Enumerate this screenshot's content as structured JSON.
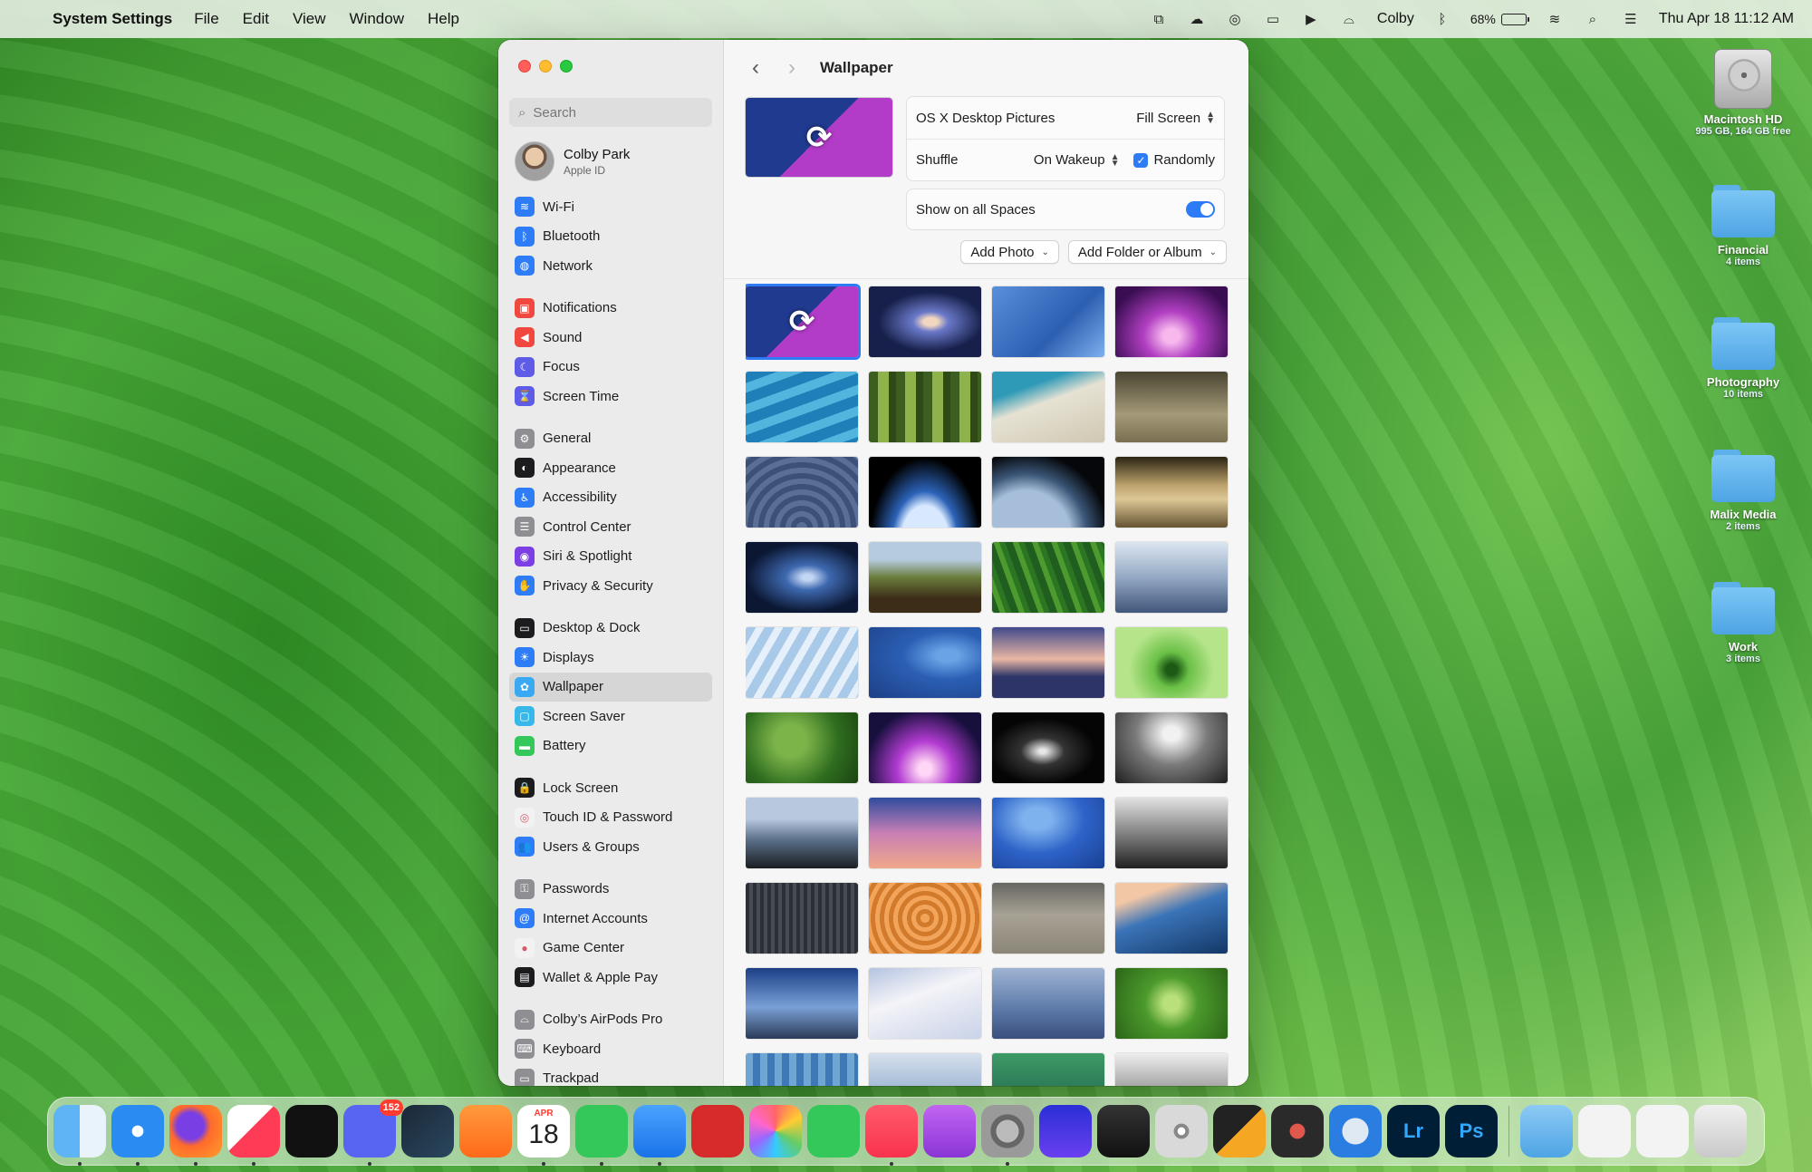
{
  "menubar": {
    "app_name": "System Settings",
    "menus": [
      "File",
      "Edit",
      "View",
      "Window",
      "Help"
    ],
    "user": "Colby",
    "battery_percent": "68%",
    "battery_level": 0.68,
    "datetime": "Thu Apr 18  11:12 AM"
  },
  "window": {
    "title": "Wallpaper",
    "search_placeholder": "Search",
    "account": {
      "name": "Colby Park",
      "subtitle": "Apple ID"
    },
    "sidebar_groups": [
      [
        {
          "label": "Wi-Fi",
          "icon": "wifi-icon",
          "color": "#2f7df6",
          "glyph": "≋"
        },
        {
          "label": "Bluetooth",
          "icon": "bluetooth-icon",
          "color": "#2f7df6",
          "glyph": "ᛒ"
        },
        {
          "label": "Network",
          "icon": "globe-icon",
          "color": "#2f7df6",
          "glyph": "◍"
        }
      ],
      [
        {
          "label": "Notifications",
          "icon": "bell-icon",
          "color": "#f0483e",
          "glyph": "▣"
        },
        {
          "label": "Sound",
          "icon": "speaker-icon",
          "color": "#f0483e",
          "glyph": "◀"
        },
        {
          "label": "Focus",
          "icon": "moon-icon",
          "color": "#5e5ce6",
          "glyph": "☾"
        },
        {
          "label": "Screen Time",
          "icon": "hourglass-icon",
          "color": "#5e5ce6",
          "glyph": "⌛"
        }
      ],
      [
        {
          "label": "General",
          "icon": "gear-icon",
          "color": "#8e8e93",
          "glyph": "⚙"
        },
        {
          "label": "Appearance",
          "icon": "appearance-icon",
          "color": "#1c1c1e",
          "glyph": "◐"
        },
        {
          "label": "Accessibility",
          "icon": "accessibility-icon",
          "color": "#2f7df6",
          "glyph": "♿"
        },
        {
          "label": "Control Center",
          "icon": "control-center-icon",
          "color": "#8e8e93",
          "glyph": "☰"
        },
        {
          "label": "Siri & Spotlight",
          "icon": "siri-icon",
          "color": "#7b3fe4",
          "glyph": "◉"
        },
        {
          "label": "Privacy & Security",
          "icon": "hand-icon",
          "color": "#2f7df6",
          "glyph": "✋"
        }
      ],
      [
        {
          "label": "Desktop & Dock",
          "icon": "dock-icon",
          "color": "#1c1c1e",
          "glyph": "▭"
        },
        {
          "label": "Displays",
          "icon": "sun-icon",
          "color": "#2f7df6",
          "glyph": "☀"
        },
        {
          "label": "Wallpaper",
          "icon": "flower-icon",
          "color": "#38a9f2",
          "glyph": "✿",
          "selected": true
        },
        {
          "label": "Screen Saver",
          "icon": "screensaver-icon",
          "color": "#38b8e8",
          "glyph": "▢"
        },
        {
          "label": "Battery",
          "icon": "battery-icon",
          "color": "#34c759",
          "glyph": "▬"
        }
      ],
      [
        {
          "label": "Lock Screen",
          "icon": "lock-icon",
          "color": "#1c1c1e",
          "glyph": "🔒"
        },
        {
          "label": "Touch ID & Password",
          "icon": "fingerprint-icon",
          "color": "#f2f2f2",
          "glyph": "◎"
        },
        {
          "label": "Users & Groups",
          "icon": "users-icon",
          "color": "#2f7df6",
          "glyph": "👥"
        }
      ],
      [
        {
          "label": "Passwords",
          "icon": "key-icon",
          "color": "#8e8e93",
          "glyph": "⚿"
        },
        {
          "label": "Internet Accounts",
          "icon": "at-icon",
          "color": "#2f7df6",
          "glyph": "@"
        },
        {
          "label": "Game Center",
          "icon": "game-center-icon",
          "color": "#f2f2f2",
          "glyph": "●"
        },
        {
          "label": "Wallet & Apple Pay",
          "icon": "wallet-icon",
          "color": "#1c1c1e",
          "glyph": "▤"
        }
      ],
      [
        {
          "label": "Colby’s AirPods Pro",
          "icon": "airpods-icon",
          "color": "#8e8e93",
          "glyph": "⌓"
        },
        {
          "label": "Keyboard",
          "icon": "keyboard-icon",
          "color": "#8e8e93",
          "glyph": "⌨"
        },
        {
          "label": "Trackpad",
          "icon": "trackpad-icon",
          "color": "#8e8e93",
          "glyph": "▭"
        }
      ]
    ],
    "wallpaper": {
      "collection": "OS X Desktop Pictures",
      "fit_mode": "Fill Screen",
      "shuffle_label": "Shuffle",
      "shuffle_value": "On Wakeup",
      "randomly_label": "Randomly",
      "randomly_checked": true,
      "show_all_spaces_label": "Show on all Spaces",
      "show_all_spaces": true,
      "add_photo": "Add Photo",
      "add_folder": "Add Folder or Album"
    },
    "thumbnails": [
      "linear-gradient(135deg,#203a8f 0 50%,#b23cc8 50%)",
      "radial-gradient(ellipse at 55% 50%,#f2d7c0 0 8%,#6a79c9 20%,#17204a 60%)",
      "linear-gradient(135deg,#5a8fdc,#2c5fb1 60%,#7fb0ee)",
      "radial-gradient(ellipse at 50% 70%,#f7b8ee 0 10%,#b13fc2 35%,#3a0d52 80%)",
      "repeating-linear-gradient(160deg,#1f7fb8 0 12px,#52b5de 12px 22px)",
      "repeating-linear-gradient(90deg,#3c5e1e 0 10px,#8fb34a 10px 22px,#2f4a16 22px 30px)",
      "linear-gradient(160deg,#2f9ab7 0 25%,#e6e2d3 45%,#cfc7b2)",
      "linear-gradient(180deg,#4a4532,#a49a79 60%,#7a6f50)",
      "repeating-radial-gradient(circle at 50% 100%,#5a6e96 0 6px,#3d5078 6px 12px)",
      "radial-gradient(ellipse at 50% 120%,#d8e9ff 0 30%,#2c63b8 42%,#000 70%)",
      "radial-gradient(ellipse at 30% 110%,#a6bed9 0 40%,#3b5677 55%,#05070a 75%)",
      "linear-gradient(180deg,#2a2412,#bca26c 40%,#ddc896 60%,#645332)",
      "radial-gradient(ellipse at 55% 50%,#c3d6f3 0 6%,#3e69b0 25%,#0b1733 70%)",
      "linear-gradient(180deg,#b6cbe0 0 25%,#6a7d3c 50%,#3c2d18 80%)",
      "repeating-linear-gradient(70deg,#1f5e1e 0 8px,#4d9a2f 8px 14px,#2c7522 14px 20px)",
      "linear-gradient(180deg,#dce6f1,#94a9c3 50%,#41567a)",
      "repeating-linear-gradient(120deg,#a9c9e8 0 10px,#e6f0fa 10px 18px)",
      "radial-gradient(ellipse at 70% 40%,#6aa3e6 0 10%,#2b5fb4 40%,#1d3f86)",
      "linear-gradient(180deg,#40498a,#e9b7a3 45%,#2d3568 70%)",
      "radial-gradient(circle at 50% 60%,#1d5a16 0 8%,#6ac046 25%,#b5e48a 60%)",
      "radial-gradient(circle at 40% 40%,#7cb44a 0 20%,#2f6d1f 60%,#1b4311)",
      "radial-gradient(ellipse at 50% 80%,#ffd6f5 0 8%,#b23bd1 35%,#17103d 75%)",
      "radial-gradient(ellipse at 45% 55%,#e6e6e6 0 4%,#333 25%,#050505 60%)",
      "radial-gradient(ellipse at 50% 30%,#f1f1f1 0 10%,#7a7a7a 45%,#1f1f1f)",
      "linear-gradient(180deg,#b7c8df 0 30%,#5a6e88 60%,#1a1e22)",
      "linear-gradient(180deg,#2f4c9e,#c87fb5 50%,#f0a88a)",
      "radial-gradient(ellipse at 40% 30%,#7eb2ee 0 15%,#2e63c8 50%,#193f92)",
      "linear-gradient(180deg,#e2e2e2,#6f6f6f 60%,#202020)",
      "repeating-linear-gradient(90deg,#2b2f36 0 4px,#464b55 4px 8px)",
      "repeating-radial-gradient(circle at 50% 50%,#f1a45a 0 5px,#d27a2c 5px 10px)",
      "linear-gradient(180deg,#666660,#a7a295 45%,#8b8677)",
      "linear-gradient(160deg,#f2c7a5 0 20%,#3a74b8 45%,#143766)",
      "linear-gradient(180deg,#1c3f86,#7aa0d6 55%,#2b3b57)",
      "linear-gradient(160deg,#b4c3e0,#f4f4f8 40%,#c9d2e8)",
      "linear-gradient(180deg,#9fb3d2,#5b78a8 60%,#3a4f7c)",
      "radial-gradient(circle at 50% 50%,#b9e07a 0 12%,#4c9a2c 40%,#2b6518)",
      "repeating-linear-gradient(90deg,#6fa6d4 0 8px,#3f78b6 8px 16px)",
      "linear-gradient(180deg,#d7e1ec,#6e91c2)",
      "linear-gradient(180deg,#3d9a64,#1a5b4e)",
      "linear-gradient(180deg,#eee,#555)"
    ],
    "selected_thumbnail": 0
  },
  "desktop_items": [
    {
      "name": "Macintosh HD",
      "sub": "995 GB, 164 GB free",
      "kind": "disk"
    },
    {
      "name": "Financial",
      "sub": "4 items",
      "kind": "folder"
    },
    {
      "name": "Photography",
      "sub": "10 items",
      "kind": "folder"
    },
    {
      "name": "Malix Media",
      "sub": "2 items",
      "kind": "folder"
    },
    {
      "name": "Work",
      "sub": "3 items",
      "kind": "folder"
    }
  ],
  "dock": {
    "apps": [
      {
        "name": "finder",
        "color": "linear-gradient(90deg,#5fb4f5 50%,#e9f3fb 50%)",
        "running": true
      },
      {
        "name": "safari",
        "color": "radial-gradient(circle,#fff 0 15%,#2a8cf2 16%)",
        "running": true
      },
      {
        "name": "firefox",
        "color": "radial-gradient(circle at 40% 40%,#7a3fe4 0 30%,#ff6a2b 45%,#ff9e2b)",
        "running": true
      },
      {
        "name": "news",
        "color": "linear-gradient(135deg,#fff 0 45%,#ff3b55 45%)",
        "running": true
      },
      {
        "name": "stocks",
        "color": "#111",
        "running": false
      },
      {
        "name": "discord",
        "color": "#5865f2",
        "running": true,
        "badge": "152"
      },
      {
        "name": "steam",
        "color": "linear-gradient(135deg,#1b2838,#2a475e)",
        "running": false
      },
      {
        "name": "pages",
        "color": "linear-gradient(180deg,#ff9a3c,#ff6a1a)",
        "running": false
      },
      {
        "name": "calendar",
        "color": "#fff",
        "running": true,
        "month": "APR",
        "day": "18"
      },
      {
        "name": "messages",
        "color": "#34c759",
        "running": true
      },
      {
        "name": "mail",
        "color": "linear-gradient(180deg,#4aa3ff,#1a73e8)",
        "running": true
      },
      {
        "name": "photo-booth",
        "color": "#d62b2b",
        "running": false
      },
      {
        "name": "photos",
        "color": "conic-gradient(#f66,#fc3,#6c6,#3cf,#96f,#f6c,#f66)",
        "running": false
      },
      {
        "name": "facetime",
        "color": "#34c759",
        "running": false
      },
      {
        "name": "music",
        "color": "linear-gradient(180deg,#ff5b6b,#f8324c)",
        "running": true
      },
      {
        "name": "podcasts",
        "color": "linear-gradient(180deg,#c166f2,#8a34d6)",
        "running": false
      },
      {
        "name": "system-settings",
        "color": "radial-gradient(circle,#bbb 0 30%,#666 31% 45%,#9a9a9a 46%)",
        "running": true
      },
      {
        "name": "audio-app",
        "color": "linear-gradient(180deg,#2a2fd6,#6a3ff0)",
        "running": false
      },
      {
        "name": "garageband",
        "color": "linear-gradient(180deg,#333,#111)",
        "running": false
      },
      {
        "name": "dvd-player",
        "color": "radial-gradient(circle,#fff 0 10%,#888 11% 20%,#d9d9d9 21%)",
        "running": false
      },
      {
        "name": "final-cut",
        "color": "linear-gradient(135deg,#222 0 50%,#f5a623 50%)",
        "running": false
      },
      {
        "name": "davinci",
        "color": "radial-gradient(circle,#e0584c 0 20%,#2a2a2a 21%)",
        "running": false
      },
      {
        "name": "quicktime",
        "color": "radial-gradient(circle,#dfe9f3 0 35%,#2a7de1 36%)",
        "running": false
      },
      {
        "name": "lightroom",
        "color": "#001e36",
        "running": false,
        "label": "Lr"
      },
      {
        "name": "photoshop",
        "color": "#001e36",
        "running": false,
        "label": "Ps"
      }
    ],
    "folders": [
      {
        "name": "downloads-stack",
        "color": "linear-gradient(180deg,#8dcaf5,#4ea4e4)"
      },
      {
        "name": "documents-stack",
        "color": "#f3f3f3"
      },
      {
        "name": "recents-stack",
        "color": "#f3f3f3"
      },
      {
        "name": "trash",
        "color": "linear-gradient(180deg,#f0f0f0,#c9c9c9)"
      }
    ]
  }
}
